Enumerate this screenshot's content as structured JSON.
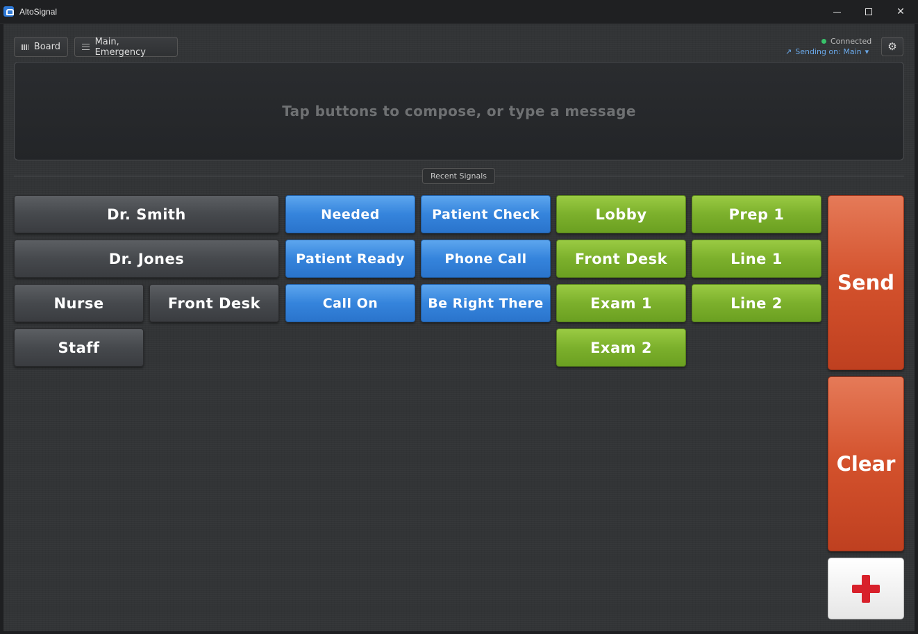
{
  "window": {
    "title": "AltoSignal"
  },
  "toolbar": {
    "board_label": "Board",
    "profile_label": "Main, Emergency",
    "status_text": "Connected",
    "sending_text": "Sending on: Main"
  },
  "compose": {
    "placeholder": "Tap buttons to compose, or type a message"
  },
  "recent": {
    "label": "Recent Signals"
  },
  "people": [
    "Dr. Smith",
    "Dr. Jones",
    "Nurse",
    "Front Desk",
    "Staff"
  ],
  "messages": [
    "Needed",
    "Patient Check",
    "Patient Ready",
    "Phone Call",
    "Call On",
    "Be Right There"
  ],
  "locations": [
    "Lobby",
    "Prep 1",
    "Front Desk",
    "Line 1",
    "Exam 1",
    "Line 2",
    "Exam 2"
  ],
  "actions": {
    "send": "Send",
    "clear": "Clear"
  },
  "colors": {
    "people": "#46494d",
    "messages": "#3584dc",
    "locations": "#7cb02c",
    "actions": "#d3512c",
    "connected": "#38c26a"
  }
}
